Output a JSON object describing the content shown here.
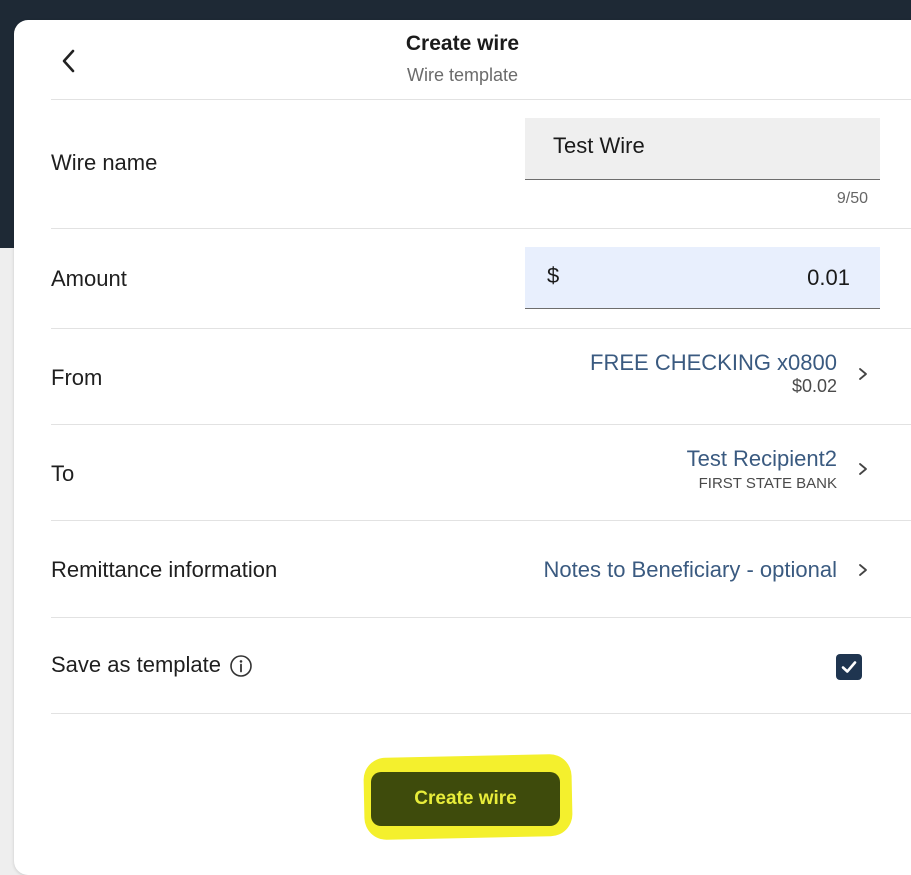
{
  "header": {
    "title": "Create wire",
    "subtitle": "Wire template",
    "back_icon": "chevron-left-icon"
  },
  "wire_name": {
    "label": "Wire name",
    "value": "Test Wire",
    "counter": "9/50"
  },
  "amount": {
    "label": "Amount",
    "currency": "$",
    "value": "0.01"
  },
  "from": {
    "label": "From",
    "account": "FREE CHECKING x0800",
    "balance": "$0.02"
  },
  "to": {
    "label": "To",
    "recipient": "Test Recipient2",
    "bank": "FIRST STATE BANK"
  },
  "remittance": {
    "label": "Remittance information",
    "placeholder": "Notes to Beneficiary - optional"
  },
  "save_template": {
    "label": "Save as template",
    "checked": true
  },
  "submit": {
    "label": "Create wire"
  },
  "colors": {
    "link": "#3a5a80",
    "button_bg": "#3e4b0c",
    "button_text": "#e8ed3a",
    "highlight": "#f4f02d",
    "checkbox": "#1f3550"
  }
}
